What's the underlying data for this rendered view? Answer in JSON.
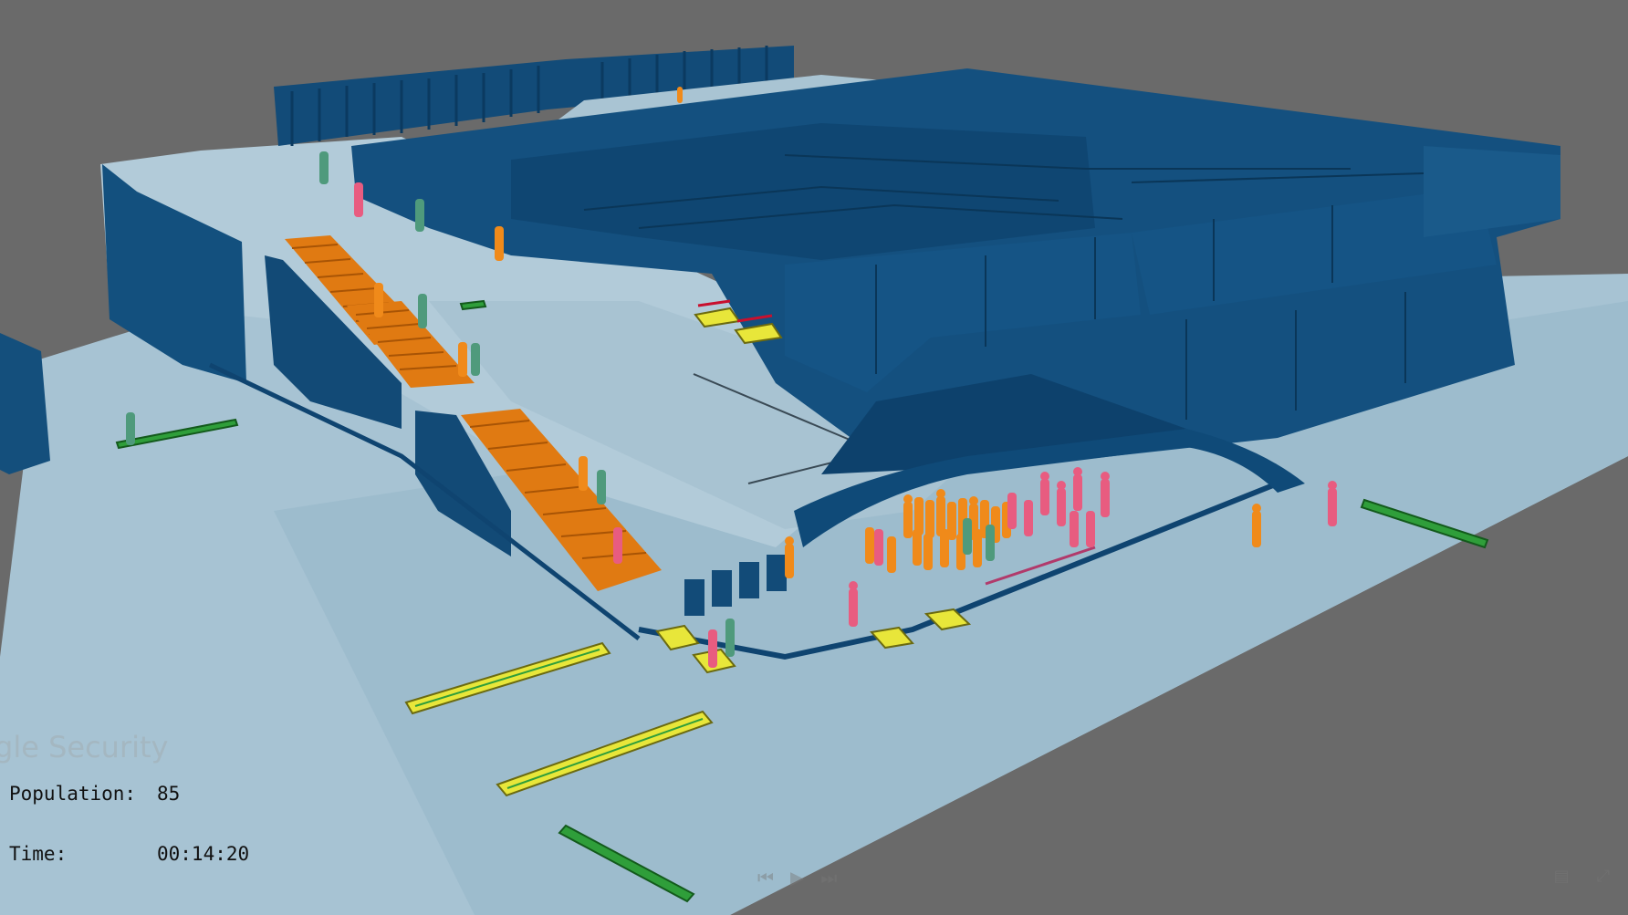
{
  "hud": {
    "population_label": "Population:",
    "population_value": "85",
    "time_label": "Time:",
    "time_value": "00:14:20"
  },
  "watermark": {
    "text": "gle Security"
  },
  "controls": {
    "prev_icon": "rewind-icon",
    "play_icon": "play-icon",
    "next_icon": "fast-forward-icon",
    "cc_icon": "captions-icon",
    "fullscreen_icon": "fullscreen-icon"
  },
  "colors": {
    "background": "#6a6a6a",
    "floor": "#a9c6d6",
    "walls": "#0f4d7a",
    "stairs": "#e07a12",
    "agent_orange": "#f08a1a",
    "agent_pink": "#e85c80",
    "agent_green": "#4f9a7c",
    "checkpoint_yellow": "#e8e63a",
    "exit_green": "#2f9e3a"
  }
}
